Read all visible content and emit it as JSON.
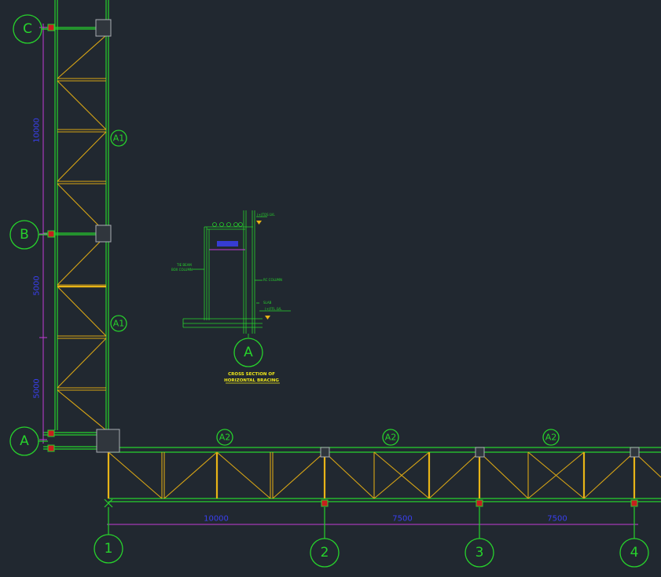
{
  "grid": {
    "rows": [
      "C",
      "B",
      "A"
    ],
    "columns": [
      "1",
      "2",
      "3",
      "4"
    ]
  },
  "bracing_tags": {
    "vertical": [
      "A1",
      "A1"
    ],
    "horizontal": [
      "A2",
      "A2",
      "A2"
    ]
  },
  "dimensions": {
    "vertical": [
      "10000",
      "5000",
      "5000"
    ],
    "horizontal": [
      "10000",
      "7500",
      "7500"
    ]
  },
  "section": {
    "bubble": "A",
    "title_line1": "CROSS SECTION OF",
    "title_line2": "HORIZONTAL BRACING",
    "labels": {
      "top_level": "(+)TOS LVL",
      "tie_beam": "TIE BEAM",
      "box_column": "BOX COLUMN",
      "rc_column": "RC COLUMN",
      "slab": "SLAB",
      "ffl_level": "(+)FFL LVL"
    }
  },
  "colors": {
    "background": "#212830",
    "grid_line": "#27d22c",
    "bracing": "#d9a615",
    "dimension_line": "#c23bd6",
    "dimension_text": "#3a3ff0",
    "note_text": "#f0e81a"
  }
}
